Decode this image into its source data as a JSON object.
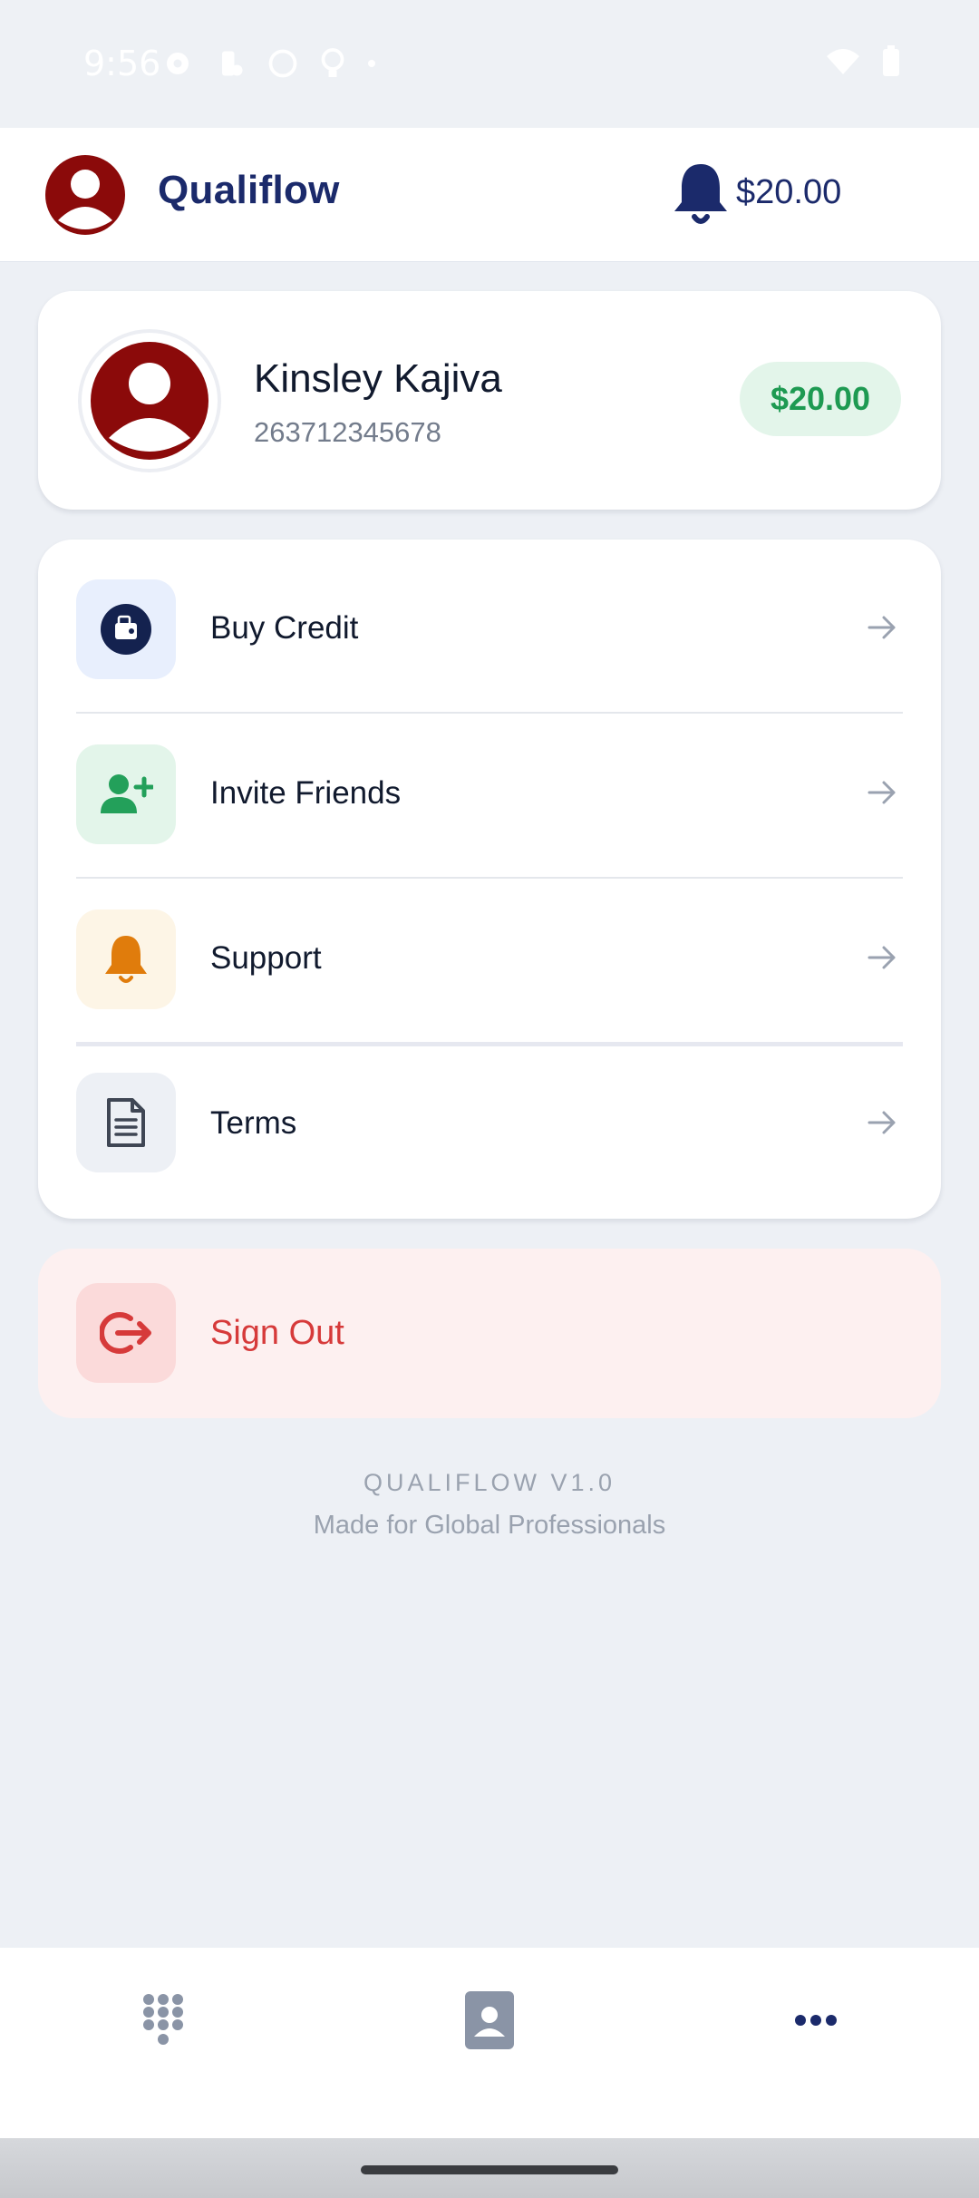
{
  "status_bar": {
    "time": "9:56"
  },
  "header": {
    "app_name": "Qualiflow",
    "balance": "$20.00"
  },
  "profile": {
    "name": "Kinsley Kajiva",
    "phone": "263712345678",
    "balance": "$20.00"
  },
  "menu": {
    "items": [
      {
        "label": "Buy Credit",
        "icon": "wallet-icon",
        "color": "#14224f",
        "bg": "#e8effd"
      },
      {
        "label": "Invite Friends",
        "icon": "user-plus-icon",
        "color": "#23a05a",
        "bg": "#e3f5ea"
      },
      {
        "label": "Support",
        "icon": "bell-icon",
        "color": "#e07c0c",
        "bg": "#fdf5e6"
      },
      {
        "label": "Terms",
        "icon": "document-icon",
        "color": "#3f4654",
        "bg": "#edf0f5"
      }
    ]
  },
  "sign_out": {
    "label": "Sign Out",
    "color": "#d63a3a"
  },
  "footer": {
    "version": "QUALIFLOW V1.0",
    "tagline": "Made for Global Professionals"
  },
  "bottom_nav": {
    "items": [
      "dialpad-icon",
      "contacts-icon",
      "more-icon"
    ]
  },
  "colors": {
    "brand": "#1b2a6b",
    "avatar": "#8b0a0a",
    "positive": "#1e9a52"
  }
}
